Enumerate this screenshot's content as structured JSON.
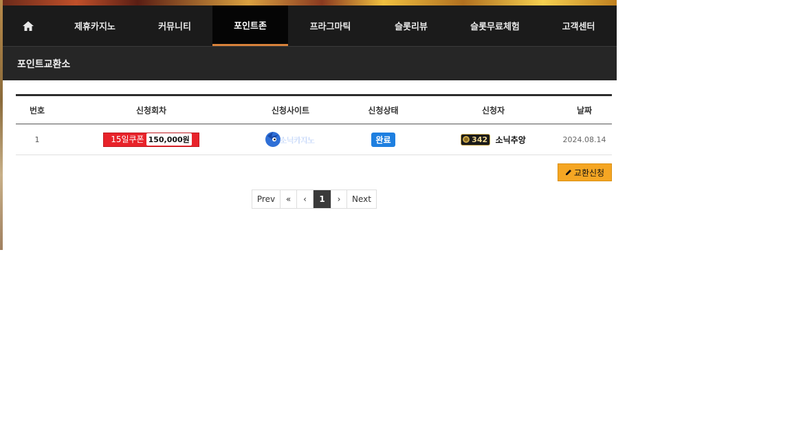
{
  "nav": {
    "home_icon": "home-icon",
    "items": [
      {
        "label": "제휴카지노"
      },
      {
        "label": "커뮤니티"
      },
      {
        "label": "포인트존",
        "active": true
      },
      {
        "label": "프라그마틱"
      },
      {
        "label": "슬롯리뷰"
      },
      {
        "label": "슬롯무료체험"
      },
      {
        "label": "고객센터"
      }
    ],
    "active_color": "#d9823a"
  },
  "page_title": "포인트교환소",
  "table": {
    "headers": [
      "번호",
      "신청회차",
      "신청사이트",
      "신청상태",
      "신청자",
      "날짜"
    ],
    "rows": [
      {
        "number": "1",
        "coupon_label": "15일쿠폰",
        "coupon_amount": "150,000원",
        "site_logo_text": "소닉카지노",
        "status": "완료",
        "user_level": "342",
        "user_name": "소닉추앙",
        "date": "2024.08.14"
      }
    ]
  },
  "exchange_button": {
    "label": "교환신청",
    "icon": "pencil-icon"
  },
  "pagination": {
    "prev": "Prev",
    "first": "«",
    "prev_arrow": "‹",
    "current": "1",
    "next_arrow": "›",
    "next": "Next"
  },
  "colors": {
    "nav_bg": "#1b1b1b",
    "coupon_red": "#e8232a",
    "status_blue": "#1e7fe0",
    "button_orange": "#f5a623"
  }
}
